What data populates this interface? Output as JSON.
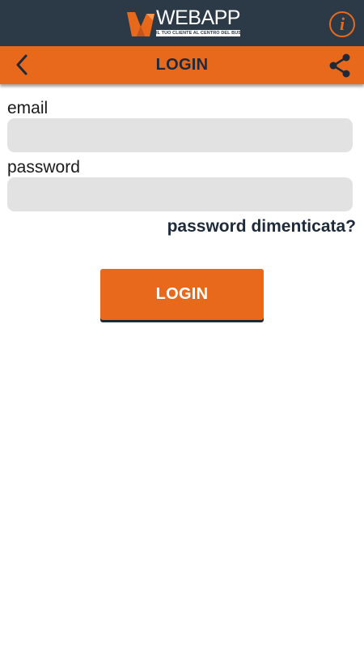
{
  "brand": {
    "name": "WEBAPP",
    "tagline": "IL TUO CLIENTE AL CENTRO DEL BUSINESS",
    "logo_icon": "webapp-logo-icon"
  },
  "header": {
    "info_icon": "info-icon",
    "info_glyph": "i"
  },
  "navbar": {
    "title": "LOGIN",
    "back_icon": "chevron-left-icon",
    "share_icon": "share-icon"
  },
  "form": {
    "email_label": "email",
    "email_value": "",
    "password_label": "password",
    "password_value": "",
    "forgot_label": "password dimenticata?",
    "submit_label": "LOGIN"
  },
  "colors": {
    "header_bg": "#2c3a47",
    "accent": "#e8691b",
    "text_dark": "#1e2a3a",
    "input_bg": "#e2e2e2"
  }
}
